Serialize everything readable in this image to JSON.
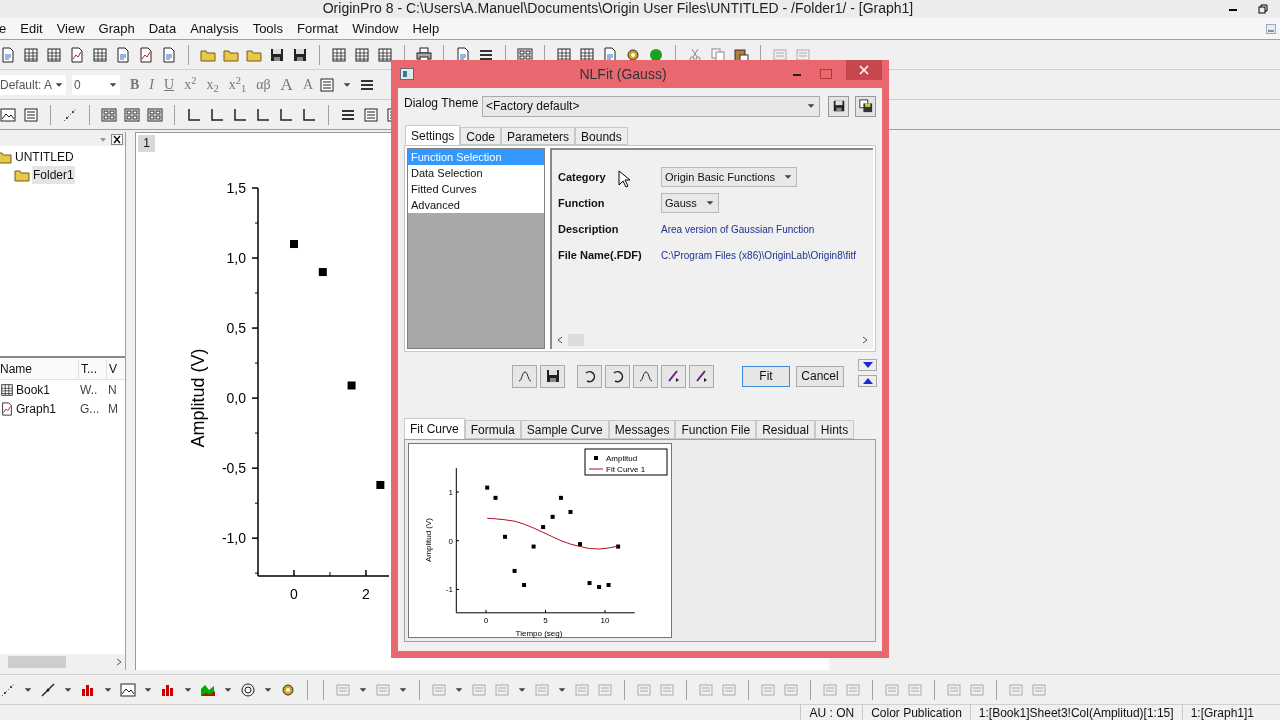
{
  "app_title": "OriginPro 8 - C:\\Users\\A.Manuel\\Documents\\Origin User Files\\UNTITLED - /Folder1/ - [Graph1]",
  "menu": [
    "e",
    "Edit",
    "View",
    "Graph",
    "Data",
    "Analysis",
    "Tools",
    "Format",
    "Window",
    "Help"
  ],
  "format_toolbar": {
    "font_combo": "Default: A",
    "size_combo": "0",
    "buttons": [
      {
        "label": "B",
        "kind": "bold"
      },
      {
        "label": "I",
        "kind": "italic"
      },
      {
        "label": "U",
        "kind": "underline"
      },
      {
        "label": "x$^{2}$",
        "kind": "plain"
      },
      {
        "label": "x$_{2}$",
        "kind": "plain"
      },
      {
        "label": "x$^{2}$$_{1}$",
        "kind": "plain"
      },
      {
        "label": "αβ",
        "kind": "plain"
      },
      {
        "label": "A",
        "kind": "large"
      },
      {
        "label": "A",
        "kind": "small"
      }
    ]
  },
  "project_explorer": {
    "tree": [
      {
        "label": "UNTITLED",
        "selected": false,
        "children": [
          {
            "label": "Folder1",
            "selected": true
          }
        ]
      }
    ],
    "columns": [
      "Name",
      "T...",
      "V"
    ],
    "rows": [
      {
        "name": "Book1",
        "type": "W..",
        "column_3": "N",
        "kind": "workbook"
      },
      {
        "name": "Graph1",
        "type": "G...",
        "column_3": "M",
        "kind": "graph"
      }
    ]
  },
  "graph": {
    "layer": "1",
    "chart_data": {
      "type": "scatter",
      "ylabel": "Amplitud (V)",
      "x": [
        0,
        0.8,
        1.6,
        2.4
      ],
      "series": [
        {
          "color": "#000000",
          "values": [
            1.1,
            0.9,
            0.09,
            -0.62
          ]
        }
      ],
      "yticks": [
        {
          "value": 1.5,
          "label": "1,5"
        },
        {
          "value": 1,
          "label": "1,0"
        },
        {
          "value": 0.5,
          "label": "0,5"
        },
        {
          "value": 0,
          "label": "0,0"
        },
        {
          "value": -0.5,
          "label": "-0,5"
        },
        {
          "value": -1,
          "label": "-1,0"
        }
      ],
      "xticks": [
        0,
        2
      ],
      "xlim": [
        -1,
        2.64
      ],
      "ylim": [
        -1.27,
        1.5
      ]
    }
  },
  "dialog": {
    "title": "NLFit (Gauss)",
    "theme_label": "Dialog Theme",
    "theme_value": "<Factory default>",
    "tabs": [
      {
        "label": "Settings",
        "selected": true
      },
      {
        "label": "Code",
        "selected": false
      },
      {
        "label": "Parameters",
        "selected": false
      },
      {
        "label": "Bounds",
        "selected": false
      }
    ],
    "nav": [
      {
        "label": "Function Selection",
        "selected": true
      },
      {
        "label": "Data Selection",
        "selected": false
      },
      {
        "label": "Fitted Curves",
        "selected": false
      },
      {
        "label": "Advanced",
        "selected": false
      }
    ],
    "fields": [
      {
        "label": "Category",
        "value": "Origin Basic Functions",
        "kind": "select"
      },
      {
        "label": "Function",
        "value": "Gauss",
        "kind": "select"
      },
      {
        "label": "Description",
        "value": "Area version of Gaussian Function",
        "kind": "text"
      },
      {
        "label": "File Name(.FDF)",
        "value": "C:\\Program Files (x86)\\OriginLab\\Origin8\\fitf",
        "kind": "text"
      }
    ],
    "buttons": [
      {
        "label": "Fit",
        "default": true
      },
      {
        "label": "Cancel",
        "default": false
      }
    ],
    "preview_tabs": [
      {
        "label": "Fit Curve",
        "selected": true
      },
      {
        "label": "Formula",
        "selected": false
      },
      {
        "label": "Sample Curve",
        "selected": false
      },
      {
        "label": "Messages",
        "selected": false
      },
      {
        "label": "Function File",
        "selected": false
      },
      {
        "label": "Residual",
        "selected": false
      },
      {
        "label": "Hints",
        "selected": false
      }
    ],
    "preview": {
      "chart_data": {
        "type": "scatter",
        "xlabel": "Tiempo (seg)",
        "ylabel": "Amplitud (V)",
        "x": [
          0.1,
          0.8,
          1.6,
          2.4,
          3.2,
          4,
          4.8,
          5.6,
          6.3,
          7.1,
          7.9,
          8.7,
          9.5,
          10.3,
          11.1
        ],
        "series": [
          {
            "name": "Amplitud",
            "color": "#000000",
            "values": [
              1.09,
              0.88,
              0.08,
              -0.62,
              -0.91,
              -0.12,
              0.28,
              0.49,
              0.88,
              0.59,
              -0.07,
              -0.87,
              -0.95,
              -0.91,
              -0.12
            ]
          },
          {
            "name": "Fit Curve 1",
            "type": "line",
            "color": "#b01020",
            "values": [
              0.46,
              0.45,
              0.43,
              0.4,
              0.34,
              0.26,
              0.17,
              0.08,
              0,
              -0.07,
              -0.12,
              -0.16,
              -0.17,
              -0.15,
              -0.11
            ]
          }
        ],
        "xticks": [
          {
            "value": 0,
            "label": "0"
          },
          {
            "value": 5,
            "label": "5"
          },
          {
            "value": 10,
            "label": "10"
          }
        ],
        "yticks": [
          {
            "value": 1,
            "label": "1"
          },
          {
            "value": 0,
            "label": "0"
          },
          {
            "value": -1,
            "label": "-1"
          }
        ],
        "xlim": [
          -2.5,
          12.5
        ],
        "ylim": [
          -1.48,
          1.49
        ],
        "legend": "upper right"
      }
    }
  },
  "status_bar": [
    "AU : ON",
    "Color Publication",
    "1:[Book1]Sheet3!Col(Amplitud)[1:15]",
    "1:[Graph1]1"
  ]
}
